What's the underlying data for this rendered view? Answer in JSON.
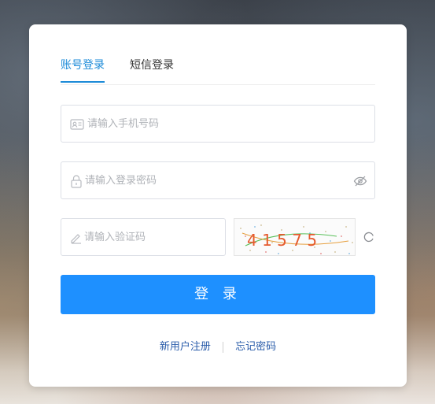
{
  "tabs": [
    {
      "label": "账号登录",
      "active": true
    },
    {
      "label": "短信登录",
      "active": false
    }
  ],
  "form": {
    "phone_placeholder": "请输入手机号码",
    "password_placeholder": "请输入登录密码",
    "captcha_placeholder": "请输入验证码",
    "captcha_text": "4 1 5 7 5",
    "login_label": "登 录"
  },
  "links": {
    "register": "新用户注册",
    "forgot": "忘记密码"
  },
  "colors": {
    "accent": "#1c8bd8",
    "button": "#1e90ff",
    "link": "#2a5caa"
  },
  "icons": {
    "phone": "id-card-icon",
    "password": "lock-icon",
    "visibility": "eye-off-icon",
    "captcha": "pencil-icon",
    "refresh": "refresh-icon"
  }
}
